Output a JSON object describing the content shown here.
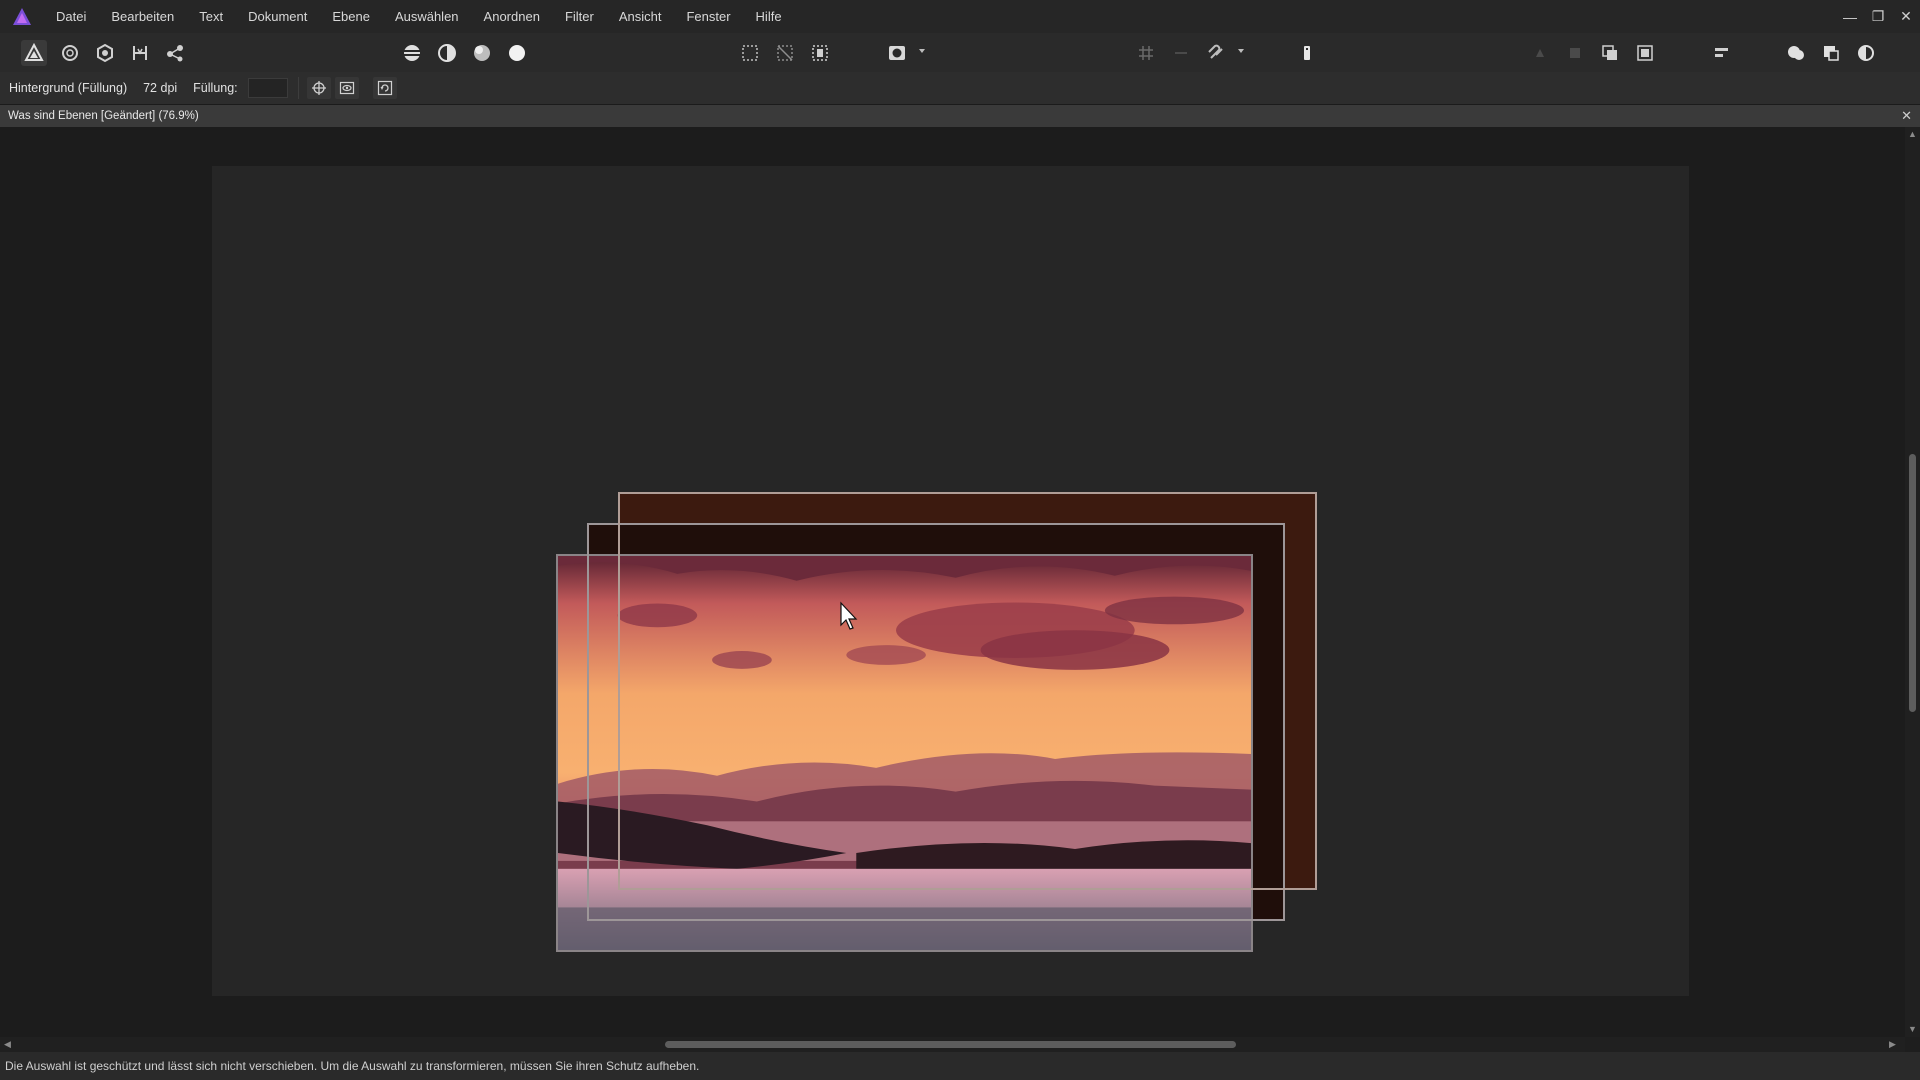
{
  "menu": {
    "items": [
      "Datei",
      "Bearbeiten",
      "Text",
      "Dokument",
      "Ebene",
      "Auswählen",
      "Anordnen",
      "Filter",
      "Ansicht",
      "Fenster",
      "Hilfe"
    ]
  },
  "window_controls": {
    "minimize": "—",
    "restore": "❐",
    "close": "✕"
  },
  "context": {
    "layer_name": "Hintergrund (Füllung)",
    "dpi": "72 dpi",
    "fill_label": "Füllung:"
  },
  "document": {
    "tab_title": "Was sind Ebenen [Geändert] (76.9%)",
    "close": "✕"
  },
  "status": {
    "message": "Die Auswahl ist geschützt und lässt sich nicht verschieben. Um die Auswahl zu transformieren, müssen Sie ihren Schutz aufheben."
  },
  "scroll": {
    "up": "▲",
    "down": "▼",
    "left": "◀",
    "right": "▶"
  },
  "colors": {
    "accent": "#8c5cf6",
    "background": "#1e1e1e",
    "artboard": "#262626"
  }
}
